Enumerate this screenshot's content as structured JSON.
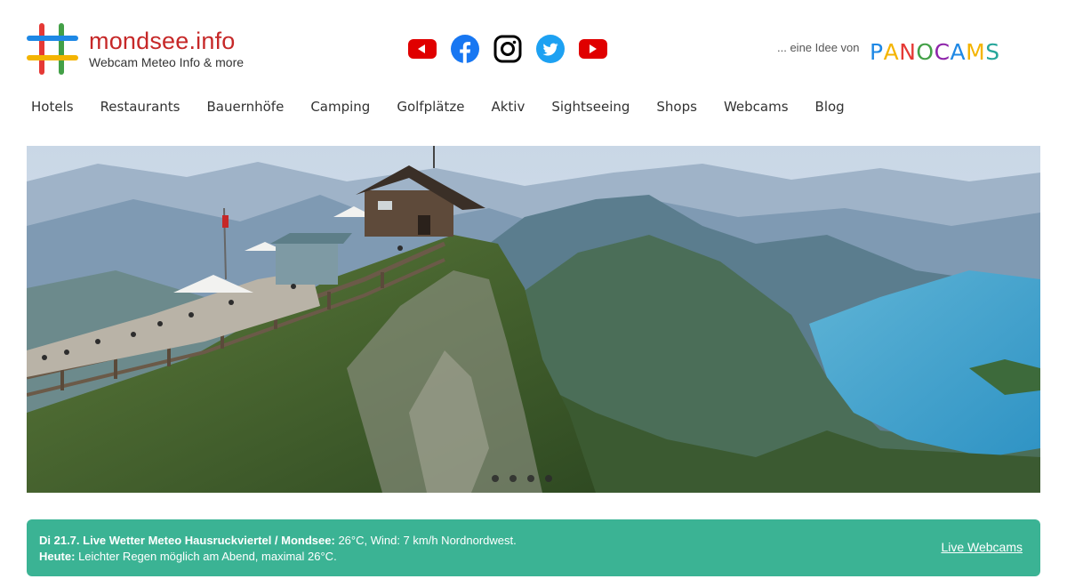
{
  "logo": {
    "title": "mondsee.info",
    "subtitle": "Webcam Meteo Info & more"
  },
  "social": [
    {
      "name": "youtube-alt-icon",
      "color": "#e00000"
    },
    {
      "name": "facebook-icon",
      "color": "#1877f2"
    },
    {
      "name": "instagram-icon",
      "color": "#000000"
    },
    {
      "name": "twitter-icon",
      "color": "#1da1f2"
    },
    {
      "name": "youtube-icon",
      "color": "#e00000"
    }
  ],
  "partner": {
    "prefix": "... eine Idee von",
    "brand": "PANOCAMS",
    "brand_colors": [
      "#1e88e5",
      "#f4b400",
      "#e53935",
      "#43a047",
      "#8e24aa",
      "#1e88e5",
      "#f4b400",
      "#26a69a"
    ]
  },
  "nav": {
    "items": [
      "Hotels",
      "Restaurants",
      "Bauernhöfe",
      "Camping",
      "Golfplätze",
      "Aktiv",
      "Sightseeing",
      "Shops",
      "Webcams",
      "Blog"
    ]
  },
  "hero": {
    "slide_count": 4
  },
  "weather": {
    "line1_label": "Di 21.7. Live Wetter Meteo Hausruckviertel / Mondsee:",
    "line1_value": " 26°C, Wind: 7 km/h Nordnordwest.",
    "line2_label": "Heute:",
    "line2_value": " Leichter Regen möglich am Abend, maximal 26°C.",
    "link": "Live Webcams",
    "bg_color": "#3bb394"
  }
}
